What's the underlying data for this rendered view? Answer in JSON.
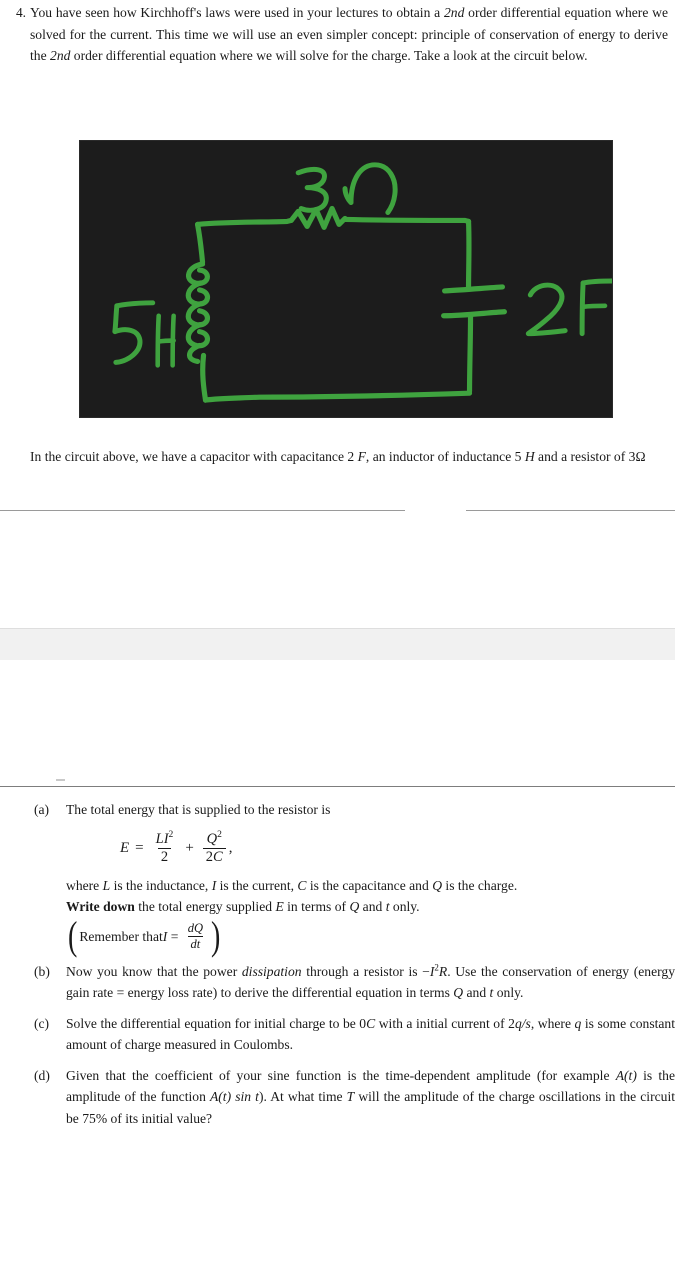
{
  "problem": {
    "number": "4.",
    "intro_parts": {
      "t1": "You have seen how Kirchhoff's laws were used in your lectures to obtain a ",
      "em1": "2nd",
      "t2": " order differential equation where we solved for the current. This time we will use an even simpler concept: principle of conservation of energy to derive the ",
      "em2": "2nd",
      "t3": " order differential equation where we will solve for the charge. Take a look at the circuit below."
    }
  },
  "figure": {
    "alt_name": "hand-drawn-rlc-circuit",
    "background_color": "#1c1c1c",
    "stroke_color": "#3fa33f",
    "labels": {
      "inductor": "5H",
      "resistor": "3Ω",
      "capacitor": "2F"
    }
  },
  "caption": {
    "t1": "In the circuit above, we have a capacitor with capacitance 2 ",
    "m1": "F",
    "t2": ", an inductor of inductance 5 ",
    "m2": "H",
    "t3": " and a resistor of 3Ω"
  },
  "parts": {
    "a": {
      "label": "(a)",
      "lead": "The total energy that is supplied to the resistor is",
      "equation": {
        "lhs": "E",
        "eq": "=",
        "term1_num": "LI",
        "term1_num_sup": "2",
        "term1_den": "2",
        "plus": "+",
        "term2_num": "Q",
        "term2_num_sup": "2",
        "term2_den": "2C",
        "trailer": ","
      },
      "where_t1": "where ",
      "where_L": "L",
      "where_t2": " is the inductance, ",
      "where_I": "I",
      "where_t3": " is the current, ",
      "where_C": "C",
      "where_t4": " is the capacitance and ",
      "where_Q": "Q",
      "where_t5": " is the charge.",
      "instruction_bold": "Write down",
      "instruction_t1": " the total energy supplied ",
      "instruction_E": "E",
      "instruction_t2": " in terms of ",
      "instruction_Q": "Q",
      "instruction_t3": " and ",
      "instruction_t": "t",
      "instruction_t4": " only.",
      "remember_t1": "Remember that ",
      "remember_I": "I",
      "remember_eq": "=",
      "remember_num": "dQ",
      "remember_den": "dt"
    },
    "b": {
      "label": "(b)",
      "t1": "Now you know that the power ",
      "em1": "dissipation",
      "t2": " through a resistor is −",
      "m1": "I",
      "m1sup": "2",
      "m2": "R",
      "t3": ". Use the conservation of energy (energy gain rate = energy loss rate) to derive the differential equation in terms ",
      "m3": "Q",
      "t4": " and ",
      "m4": "t",
      "t5": " only."
    },
    "c": {
      "label": "(c)",
      "t1": "Solve the differential equation for initial charge to be 0",
      "m1": "C",
      "t2": " with a initial current of 2",
      "m2": "q/s",
      "t3": ", where ",
      "m3": "q",
      "t4": " is some constant amount of charge measured in Coulombs."
    },
    "d": {
      "label": "(d)",
      "t1": "Given that the coefficient of your sine function is the time-dependent amplitude (for example ",
      "m1": "A(t)",
      "t2": " is the amplitude of the function ",
      "m2": "A(t) sin t",
      "t3": "). At what time ",
      "m3": "T",
      "t4": " will the amplitude of the charge oscillations in the circuit be 75% of its initial value?"
    }
  },
  "colors": {
    "text": "#1a1a1a",
    "rule": "#8d8d8d",
    "band": "#f1f1f1",
    "figure_bg": "#1c1c1c",
    "figure_ink": "#3fa33f"
  }
}
